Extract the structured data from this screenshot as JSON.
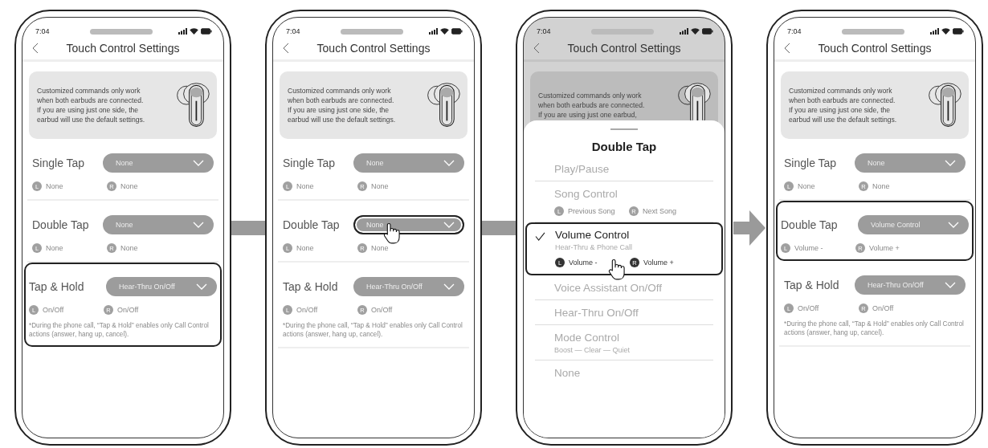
{
  "screens": [
    {
      "time": "7:04",
      "title": "Touch Control Settings",
      "dimmed": false,
      "info": [
        "Customized commands only work",
        "when both earbuds are connected.",
        "If you are using just one side, the",
        "earbud will use the default settings."
      ],
      "settings": [
        {
          "label": "Single Tap",
          "value": "None",
          "left": {
            "side": "L",
            "text": "None"
          },
          "right": {
            "side": "R",
            "text": "None"
          },
          "highlighted": false,
          "pressed": false
        },
        {
          "label": "Double Tap",
          "value": "None",
          "left": {
            "side": "L",
            "text": "None"
          },
          "right": {
            "side": "R",
            "text": "None"
          },
          "highlighted": false,
          "pressed": false
        },
        {
          "label": "Tap & Hold",
          "value": "Hear-Thru On/Off",
          "left": {
            "side": "L",
            "text": "On/Off"
          },
          "right": {
            "side": "R",
            "text": "On/Off"
          },
          "note": "*During the phone call, “Tap & Hold” enables only Call Control actions (answer, hang up, cancel).",
          "highlighted": true,
          "pressed": false
        }
      ]
    },
    {
      "time": "7:04",
      "title": "Touch Control Settings",
      "dimmed": false,
      "info": [
        "Customized commands only work",
        "when both earbuds are connected.",
        "If you are using just one side, the",
        "earbud will use the default settings."
      ],
      "settings": [
        {
          "label": "Single Tap",
          "value": "None",
          "left": {
            "side": "L",
            "text": "None"
          },
          "right": {
            "side": "R",
            "text": "None"
          },
          "highlighted": false,
          "pressed": false
        },
        {
          "label": "Double Tap",
          "value": "None",
          "left": {
            "side": "L",
            "text": "None"
          },
          "right": {
            "side": "R",
            "text": "None"
          },
          "highlighted": false,
          "pressed": true
        },
        {
          "label": "Tap & Hold",
          "value": "Hear-Thru On/Off",
          "left": {
            "side": "L",
            "text": "On/Off"
          },
          "right": {
            "side": "R",
            "text": "On/Off"
          },
          "note": "*During the phone call, “Tap & Hold” enables only Call Control actions (answer, hang up, cancel).",
          "highlighted": false,
          "pressed": false
        }
      ]
    },
    {
      "time": "7:04",
      "title": "Touch Control Settings",
      "dimmed": true,
      "info": [
        "Customized commands only work",
        "when both earbuds are connected.",
        "If you are using just one earbud,"
      ],
      "sheet": {
        "title": "Double Tap",
        "options": [
          {
            "label": "Play/Pause",
            "checked": false,
            "highlighted": false,
            "pressed": false
          },
          {
            "label": "Song Control",
            "left": {
              "side": "L",
              "text": "Previous Song"
            },
            "right": {
              "side": "R",
              "text": "Next Song"
            },
            "checked": false,
            "highlighted": false,
            "pressed": false
          },
          {
            "label": "Volume Control",
            "sub": "Hear-Thru & Phone Call",
            "left": {
              "side": "L",
              "text": "Volume -"
            },
            "right": {
              "side": "R",
              "text": "Volume +"
            },
            "checked": true,
            "highlighted": true,
            "pressed": true
          },
          {
            "label": "Voice Assistant On/Off",
            "checked": false,
            "highlighted": false,
            "pressed": false
          },
          {
            "label": "Hear-Thru On/Off",
            "checked": false,
            "highlighted": false,
            "pressed": false
          },
          {
            "label": "Mode Control",
            "sub": "Boost — Clear — Quiet",
            "checked": false,
            "highlighted": false,
            "pressed": false
          },
          {
            "label": "None",
            "checked": false,
            "highlighted": false,
            "pressed": false
          }
        ]
      }
    },
    {
      "time": "7:04",
      "title": "Touch Control Settings",
      "dimmed": false,
      "info": [
        "Customized commands only work",
        "when both earbuds are connected.",
        "If you are using just one side, the",
        "earbud will use the default settings."
      ],
      "settings": [
        {
          "label": "Single Tap",
          "value": "None",
          "left": {
            "side": "L",
            "text": "None"
          },
          "right": {
            "side": "R",
            "text": "None"
          },
          "highlighted": false,
          "pressed": false
        },
        {
          "label": "Double Tap",
          "value": "Volume Control",
          "left": {
            "side": "L",
            "text": "Volume -"
          },
          "right": {
            "side": "R",
            "text": "Volume +"
          },
          "highlighted": true,
          "pressed": false
        },
        {
          "label": "Tap & Hold",
          "value": "Hear-Thru On/Off",
          "left": {
            "side": "L",
            "text": "On/Off"
          },
          "right": {
            "side": "R",
            "text": "On/Off"
          },
          "note": "*During the phone call, “Tap & Hold” enables only Call Control actions (answer, hang up, cancel).",
          "highlighted": false,
          "pressed": false
        }
      ]
    }
  ],
  "connectors": [
    {
      "kind": "bar"
    },
    {
      "kind": "bar"
    },
    {
      "kind": "arrow"
    }
  ]
}
